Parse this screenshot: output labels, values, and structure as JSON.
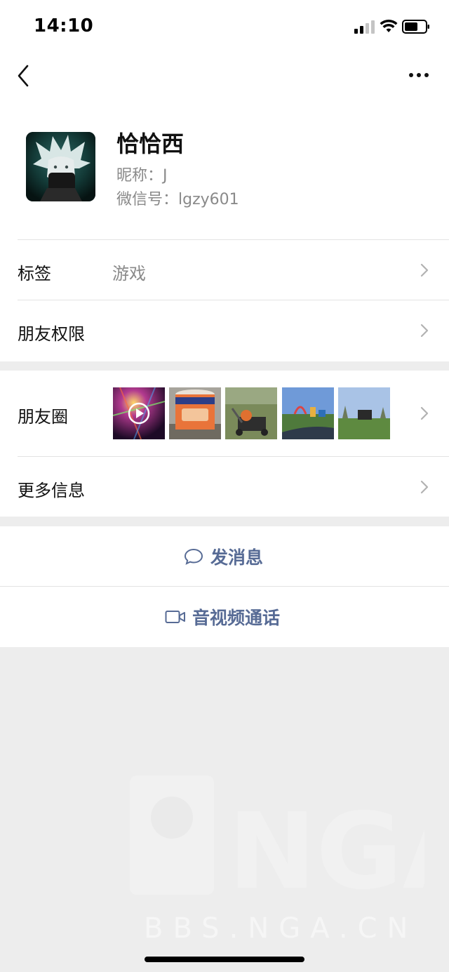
{
  "status_bar": {
    "time": "14:10"
  },
  "profile": {
    "display_name": "恰恰西",
    "nickname": "昵称：J",
    "wechat_id": "微信号：lgzy601"
  },
  "rows": {
    "tag_label": "标签",
    "tag_value": "游戏",
    "permissions_label": "朋友权限",
    "moments_label": "朋友圈",
    "more_info_label": "更多信息"
  },
  "actions": {
    "send_message": "发消息",
    "video_call": "音视频通话"
  },
  "watermark": {
    "text": "BBS.NGA.CN",
    "logo": "NGA"
  },
  "colors": {
    "link": "#576b95",
    "background": "#ededed"
  }
}
